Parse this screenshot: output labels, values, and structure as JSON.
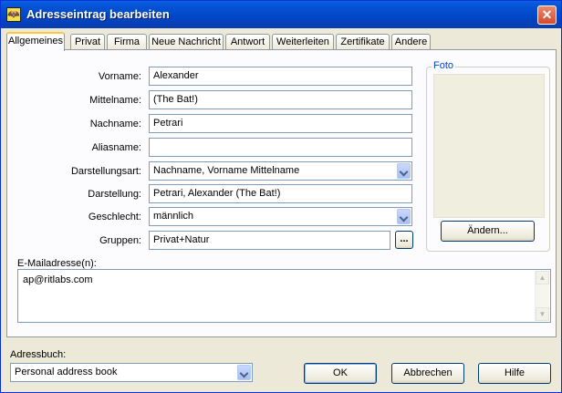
{
  "window": {
    "title": "Adresseintrag bearbeiten",
    "close_glyph": "✕",
    "icon": "bat-icon"
  },
  "tabs": [
    {
      "label": "Allgemeines"
    },
    {
      "label": "Privat"
    },
    {
      "label": "Firma"
    },
    {
      "label": "Neue Nachricht"
    },
    {
      "label": "Antwort"
    },
    {
      "label": "Weiterleiten"
    },
    {
      "label": "Zertifikate"
    },
    {
      "label": "Andere"
    }
  ],
  "form": {
    "vorname": {
      "label": "Vorname:",
      "value": "Alexander"
    },
    "mittelname": {
      "label": "Mittelname:",
      "value": "(The Bat!)"
    },
    "nachname": {
      "label": "Nachname:",
      "value": "Petrari"
    },
    "aliasname": {
      "label": "Aliasname:",
      "value": ""
    },
    "darstellungsart": {
      "label": "Darstellungsart:",
      "value": "Nachname, Vorname Mittelname"
    },
    "darstellung": {
      "label": "Darstellung:",
      "value": "Petrari, Alexander (The Bat!)"
    },
    "geschlecht": {
      "label": "Geschlecht:",
      "value": "männlich"
    },
    "gruppen": {
      "label": "Gruppen:",
      "value": "Privat+Natur",
      "button": "..."
    }
  },
  "foto": {
    "title": "Foto",
    "change_button": "Ändern..."
  },
  "email": {
    "label": "E-Mailadresse(n):",
    "value": "ap@ritlabs.com"
  },
  "adressbuch": {
    "label": "Adressbuch:",
    "value": "Personal address book"
  },
  "buttons": {
    "ok": "OK",
    "cancel": "Abbrechen",
    "help": "Hilfe"
  },
  "colors": {
    "titlebar": "#0054e3",
    "accent_tab": "#ffc83c",
    "group_title": "#0046d5"
  }
}
